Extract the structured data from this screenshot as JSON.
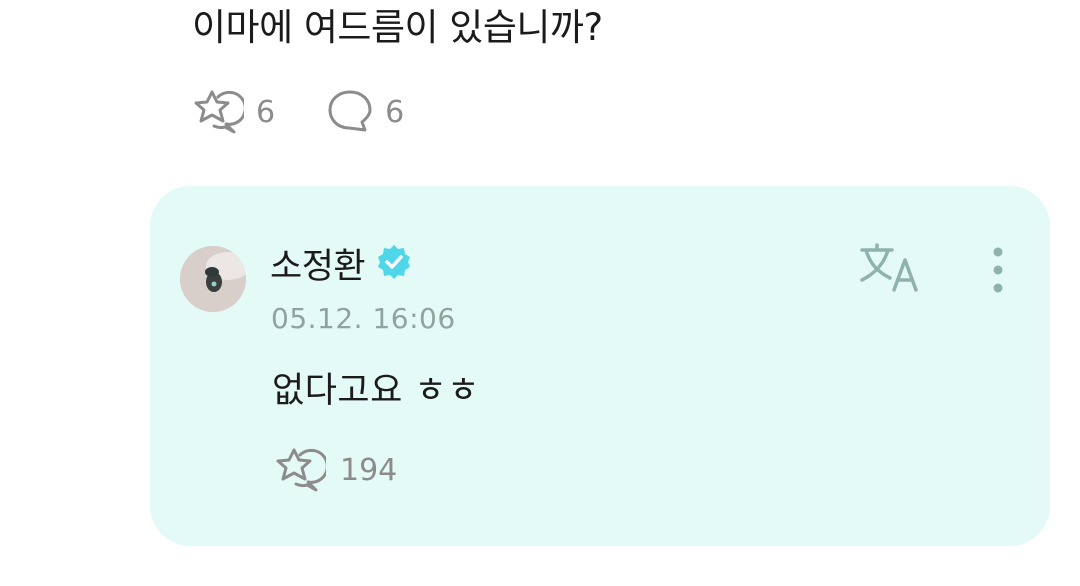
{
  "post": {
    "text": "이마에 여드름이 있습니까?",
    "like_count": "6",
    "comment_count": "6",
    "like_icon": "star-bubble-icon",
    "comment_icon": "speech-bubble-icon"
  },
  "reply": {
    "author": "소정환",
    "verified_icon": "verified-badge-icon",
    "timestamp": "05.12. 16:06",
    "text": "없다고요 ㅎㅎ",
    "like_count": "194",
    "translate_icon": "translate-icon",
    "more_icon": "more-vertical-icon",
    "card_color": "#e4faf6",
    "accent_color": "#4fd6e8"
  }
}
